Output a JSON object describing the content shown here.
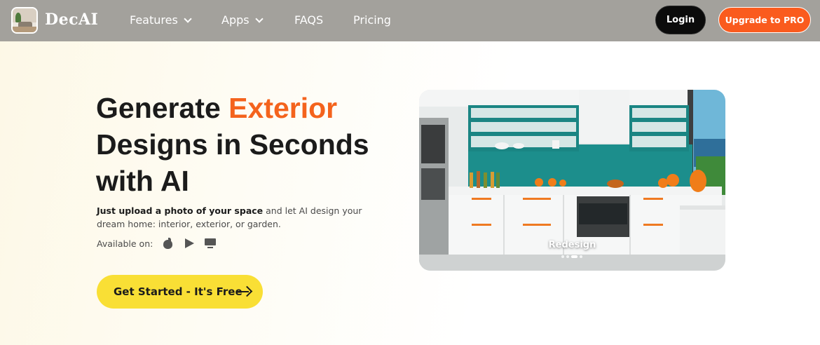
{
  "nav": {
    "brand": "DecAI",
    "items": [
      {
        "label": "Features",
        "has_dropdown": true
      },
      {
        "label": "Apps",
        "has_dropdown": true
      },
      {
        "label": "FAQS",
        "has_dropdown": false
      },
      {
        "label": "Pricing",
        "has_dropdown": false
      }
    ],
    "login_label": "Login",
    "upgrade_label": "Upgrade to PRO"
  },
  "hero": {
    "title_part1": "Generate",
    "title_accent": "Exterior",
    "title_part2": "Designs in Seconds",
    "title_part3": "with AI",
    "subtitle_bold": "Just upload a photo of your space",
    "subtitle_rest": "and let AI design your dream home: interior, exterior, or garden.",
    "available_on": "Available on:",
    "platform_icons": [
      "apple-icon",
      "google-play-icon",
      "desktop-icon"
    ],
    "cta_label": "Get Started - It's Free"
  },
  "showcase": {
    "caption": "Redesign",
    "slide_count": 4,
    "active_slide": 3
  },
  "colors": {
    "nav_bg": "#a3a19c",
    "accent_orange": "#f4631d",
    "upgrade_bg": "#fa5b1e",
    "cta_yellow": "#f9df35",
    "login_bg": "#0b0b0b"
  }
}
